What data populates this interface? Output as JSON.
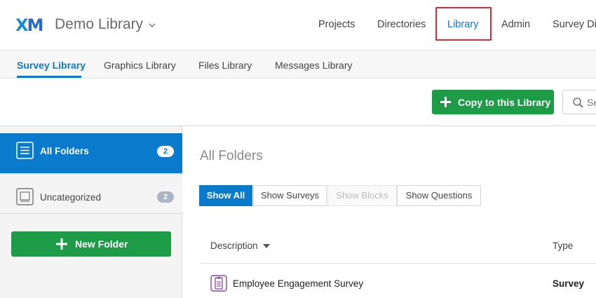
{
  "header": {
    "logo_x": "X",
    "logo_m": "M",
    "library_title": "Demo Library",
    "nav": [
      {
        "label": "Projects"
      },
      {
        "label": "Directories"
      },
      {
        "label": "Library"
      },
      {
        "label": "Admin"
      },
      {
        "label": "Survey Dir"
      }
    ]
  },
  "subtabs": [
    {
      "label": "Survey Library"
    },
    {
      "label": "Graphics Library"
    },
    {
      "label": "Files Library"
    },
    {
      "label": "Messages Library"
    }
  ],
  "toolbar": {
    "copy_label": "Copy to this Library",
    "search_placeholder": "Se"
  },
  "sidebar": {
    "folders": [
      {
        "label": "All Folders",
        "count": "2"
      },
      {
        "label": "Uncategorized",
        "count": "2"
      }
    ],
    "new_folder_label": "New Folder"
  },
  "main": {
    "title": "All Folders",
    "filters": [
      {
        "label": "Show All"
      },
      {
        "label": "Show Surveys"
      },
      {
        "label": "Show Blocks"
      },
      {
        "label": "Show Questions"
      }
    ],
    "columns": {
      "description": "Description",
      "type": "Type"
    },
    "rows": [
      {
        "description": "Employee Engagement Survey",
        "type": "Survey"
      }
    ]
  },
  "colors": {
    "accent": "#0a7acc",
    "green": "#1e9b47",
    "highlight": "#c9323a"
  }
}
